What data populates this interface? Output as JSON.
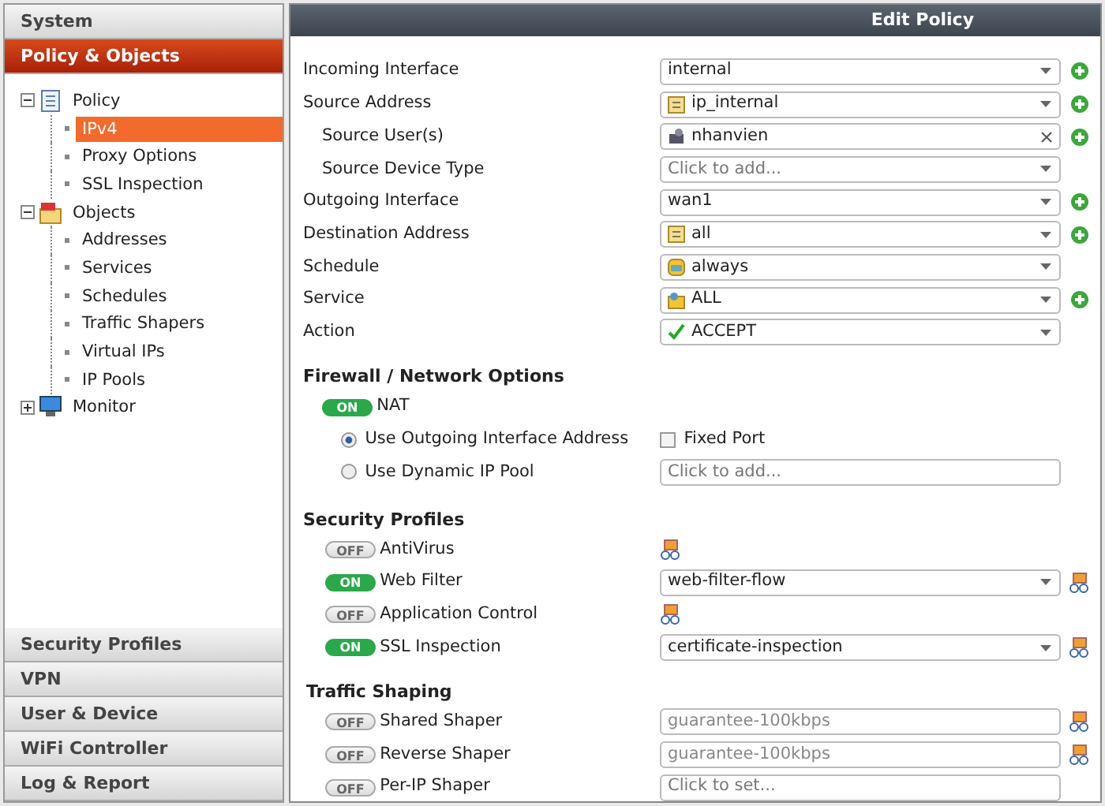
{
  "sidebar": {
    "top_sections": [
      {
        "label": "System",
        "selected": false
      },
      {
        "label": "Policy & Objects",
        "selected": true
      }
    ],
    "tree": [
      {
        "label": "Policy",
        "kind": "policy",
        "expanded": true,
        "children": [
          {
            "label": "IPv4",
            "selected": true
          },
          {
            "label": "Proxy Options",
            "selected": false
          },
          {
            "label": "SSL Inspection",
            "selected": false
          }
        ]
      },
      {
        "label": "Objects",
        "kind": "objects",
        "expanded": true,
        "children": [
          {
            "label": "Addresses",
            "selected": false
          },
          {
            "label": "Services",
            "selected": false
          },
          {
            "label": "Schedules",
            "selected": false
          },
          {
            "label": "Traffic Shapers",
            "selected": false
          },
          {
            "label": "Virtual IPs",
            "selected": false
          },
          {
            "label": "IP Pools",
            "selected": false
          }
        ]
      },
      {
        "label": "Monitor",
        "kind": "monitor",
        "expanded": false
      }
    ],
    "bottom_sections": [
      {
        "label": "Security Profiles",
        "selected": false
      },
      {
        "label": "VPN",
        "selected": false
      },
      {
        "label": "User & Device",
        "selected": false
      },
      {
        "label": "WiFi Controller",
        "selected": false
      },
      {
        "label": "Log & Report",
        "selected": false
      }
    ]
  },
  "title": "Edit Policy",
  "fields": [
    {
      "label": "Incoming Interface",
      "kind": "plain",
      "value": "internal",
      "addable": true
    },
    {
      "label": "Source Address",
      "kind": "address",
      "value": "ip_internal",
      "addable": true,
      "children": [
        {
          "label": "Source User(s)",
          "kind": "user",
          "value": "nhanvien",
          "addable": true
        },
        {
          "label": "Source Device Type",
          "kind": "plain",
          "placeholder": "Click to add...",
          "addable": false
        }
      ]
    },
    {
      "label": "Outgoing Interface",
      "kind": "plain",
      "value": "wan1",
      "addable": true
    },
    {
      "label": "Destination Address",
      "kind": "address",
      "value": "all",
      "addable": true
    },
    {
      "label": "Schedule",
      "kind": "schedule",
      "value": "always",
      "addable": false
    },
    {
      "label": "Service",
      "kind": "service",
      "value": "ALL",
      "addable": true
    },
    {
      "label": "Action",
      "kind": "accept",
      "value": "ACCEPT",
      "addable": false
    }
  ],
  "firewall": {
    "heading": "Firewall / Network Options",
    "nat": {
      "label": "NAT",
      "on": true,
      "toggle_text": "ON"
    },
    "options": [
      {
        "label": "Use Outgoing Interface Address",
        "selected": true
      },
      {
        "label": "Use Dynamic IP Pool",
        "selected": false
      }
    ],
    "fixed_port": {
      "label": "Fixed Port",
      "checked": false
    },
    "pool_field": {
      "placeholder": "Click to add..."
    }
  },
  "security_profiles": {
    "heading": "Security Profiles",
    "items": [
      {
        "label": "AntiVirus",
        "on": false,
        "toggle_text": "OFF",
        "kind": "icon"
      },
      {
        "label": "Web Filter",
        "on": true,
        "toggle_text": "ON",
        "kind": "select",
        "value": "web-filter-flow"
      },
      {
        "label": "Application Control",
        "on": false,
        "toggle_text": "OFF",
        "kind": "icon"
      },
      {
        "label": "SSL Inspection",
        "on": true,
        "toggle_text": "ON",
        "kind": "select",
        "value": "certificate-inspection"
      }
    ]
  },
  "traffic_shaping": {
    "heading": "Traffic Shaping",
    "items": [
      {
        "label": "Shared Shaper",
        "on": false,
        "toggle_text": "OFF",
        "value": "guarantee-100kbps",
        "editable": true
      },
      {
        "label": "Reverse Shaper",
        "on": false,
        "toggle_text": "OFF",
        "value": "guarantee-100kbps",
        "editable": true
      },
      {
        "label": "Per-IP Shaper",
        "on": false,
        "toggle_text": "OFF",
        "placeholder": "Click to set...",
        "editable": false
      }
    ]
  }
}
